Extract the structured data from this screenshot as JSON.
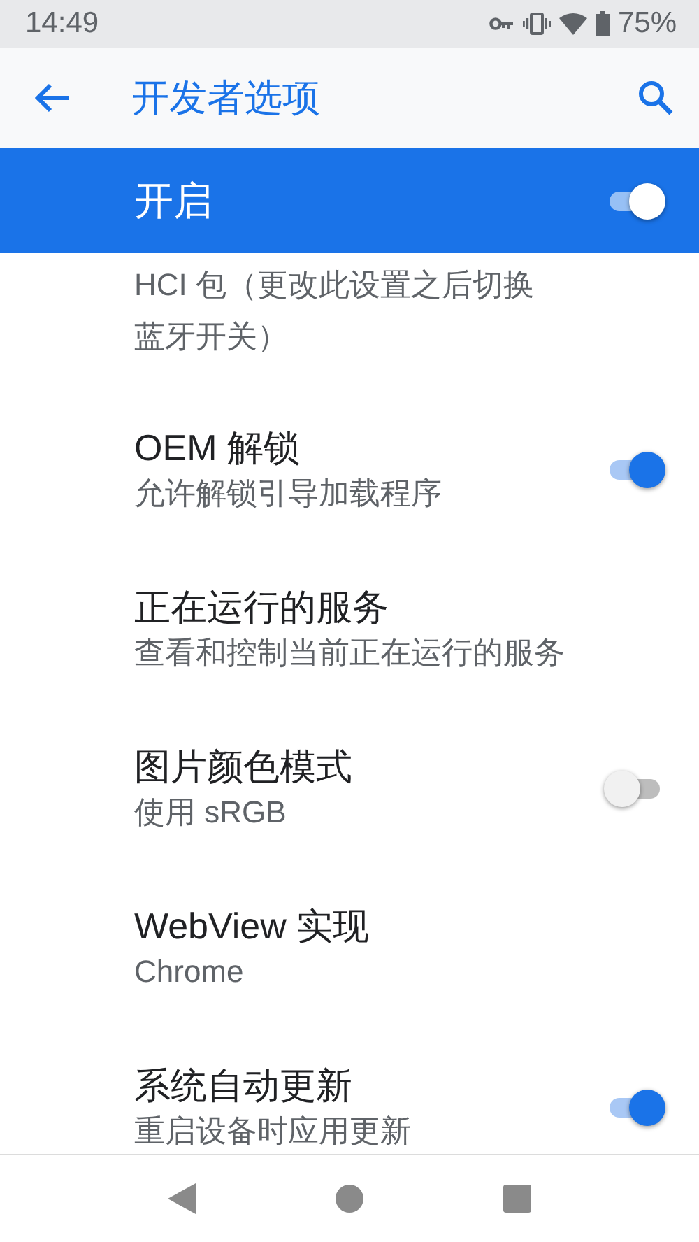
{
  "status_bar": {
    "time": "14:49",
    "battery": "75%"
  },
  "app_bar": {
    "title": "开发者选项"
  },
  "master_switch": {
    "label": "开启",
    "on": true
  },
  "items": [
    {
      "kind": "cut",
      "summary": "HCI 包（更改此设置之后切换蓝牙开关）"
    },
    {
      "kind": "switch",
      "title": "OEM 解锁",
      "summary": "允许解锁引导加载程序",
      "on": true
    },
    {
      "kind": "plain",
      "title": "正在运行的服务",
      "summary": "查看和控制当前正在运行的服务"
    },
    {
      "kind": "switch",
      "title": "图片颜色模式",
      "summary": "使用 sRGB",
      "on": false
    },
    {
      "kind": "plain",
      "title": "WebView 实现",
      "summary": "Chrome"
    },
    {
      "kind": "switch",
      "title": "系统自动更新",
      "summary": "重启设备时应用更新",
      "on": true
    }
  ]
}
